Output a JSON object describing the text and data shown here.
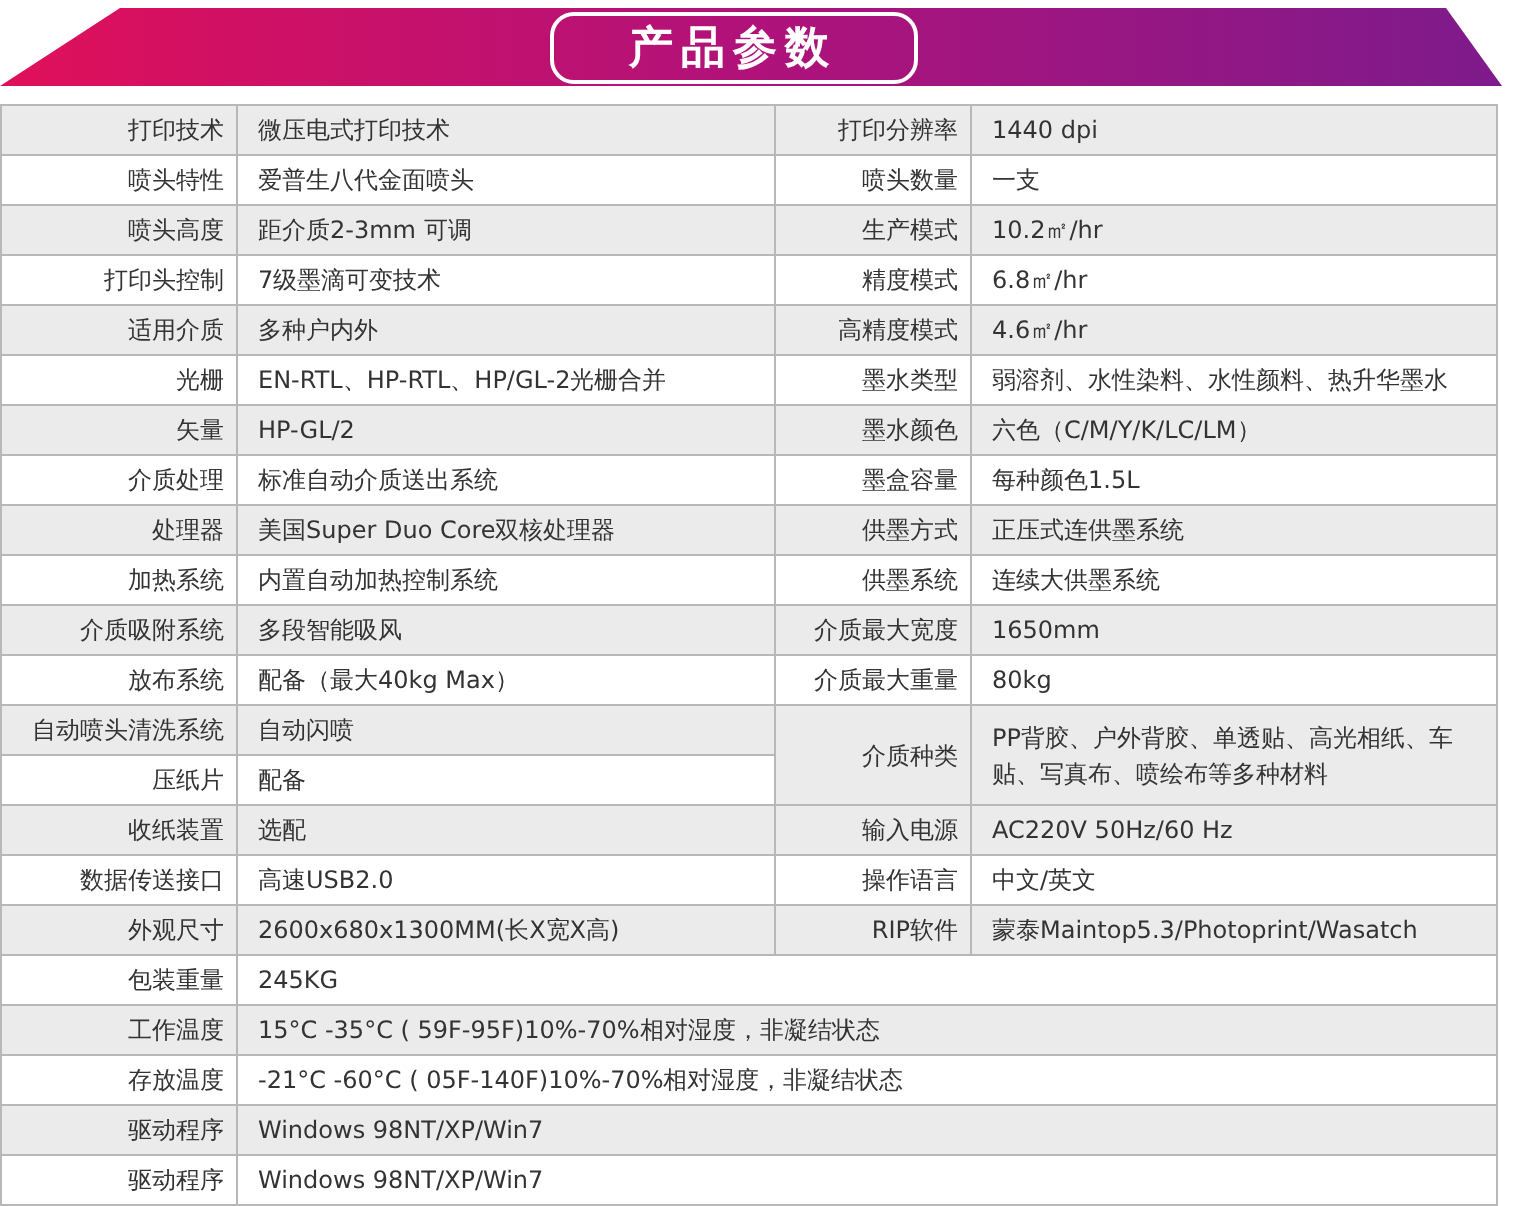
{
  "title": "产品参数",
  "rows": [
    {
      "kind": "pair",
      "label": "打印技术",
      "value": "微压电式打印技术",
      "label_2": "打印分辨率",
      "value_2": "1440 dpi"
    },
    {
      "kind": "pair",
      "label": "喷头特性",
      "value": "爱普生八代金面喷头",
      "label_2": "喷头数量",
      "value_2": "一支"
    },
    {
      "kind": "pair",
      "label": "喷头高度",
      "value": "距介质2-3mm 可调",
      "label_2": "生产模式",
      "value_2": "10.2㎡/hr"
    },
    {
      "kind": "pair",
      "label": "打印头控制",
      "value": "7级墨滴可变技术",
      "label_2": "精度模式",
      "value_2": "6.8㎡/hr"
    },
    {
      "kind": "pair",
      "label": "适用介质",
      "value": "多种户内外",
      "label_2": "高精度模式",
      "value_2": "4.6㎡/hr"
    },
    {
      "kind": "pair",
      "label": "光栅",
      "value": "EN-RTL、HP-RTL、HP/GL-2光栅合并",
      "label_2": "墨水类型",
      "value_2": "弱溶剂、水性染料、水性颜料、热升华墨水"
    },
    {
      "kind": "pair",
      "label": "矢量",
      "value": "HP-GL/2",
      "label_2": "墨水颜色",
      "value_2": "六色（C/M/Y/K/LC/LM）"
    },
    {
      "kind": "pair",
      "label": "介质处理",
      "value": "标准自动介质送出系统",
      "label_2": "墨盒容量",
      "value_2": "每种颜色1.5L"
    },
    {
      "kind": "pair",
      "label": "处理器",
      "value": "美国Super Duo Core双核处理器",
      "label_2": "供墨方式",
      "value_2": "正压式连供墨系统"
    },
    {
      "kind": "pair",
      "label": "加热系统",
      "value": "内置自动加热控制系统",
      "label_2": "供墨系统",
      "value_2": "连续大供墨系统"
    },
    {
      "kind": "pair",
      "label": "介质吸附系统",
      "value": "多段智能吸风",
      "label_2": "介质最大宽度",
      "value_2": "1650mm"
    },
    {
      "kind": "pair",
      "label": "放布系统",
      "value": "配备（最大40kg  Max）",
      "label_2": "介质最大重量",
      "value_2": "80kg"
    },
    {
      "kind": "pair",
      "label": "自动喷头清洗系统",
      "value": "自动闪喷",
      "label_2": "介质种类",
      "value_2": "PP背胶、户外背胶、单透贴、高光相纸、车贴、写真布、喷绘布等多种材料"
    },
    {
      "kind": "left_only",
      "label": "压纸片",
      "value": "配备"
    },
    {
      "kind": "pair",
      "label": "收纸装置",
      "value": "选配",
      "label_2": "输入电源",
      "value_2": "AC220V 50Hz/60 Hz"
    },
    {
      "kind": "pair",
      "label": "数据传送接口",
      "value": "高速USB2.0",
      "label_2": "操作语言",
      "value_2": "中文/英文"
    },
    {
      "kind": "pair",
      "label": "外观尺寸",
      "value": "2600x680x1300MM(长X宽X高)",
      "label_2": "RIP软件",
      "value_2": "蒙泰Maintop5.3/Photoprint/Wasatch"
    },
    {
      "kind": "full",
      "label": "包装重量",
      "value": "245KG"
    },
    {
      "kind": "full",
      "label": "工作温度",
      "value": "15°C -35°C ( 59F-95F)10%-70%相对湿度，非凝结状态"
    },
    {
      "kind": "full",
      "label": "存放温度",
      "value": "-21°C -60°C ( 05F-140F)10%-70%相对湿度，非凝结状态"
    },
    {
      "kind": "full",
      "label": "驱动程序",
      "value": "Windows 98NT/XP/Win7"
    },
    {
      "kind": "full",
      "label": "驱动程序",
      "value": "Windows 98NT/XP/Win7"
    }
  ]
}
